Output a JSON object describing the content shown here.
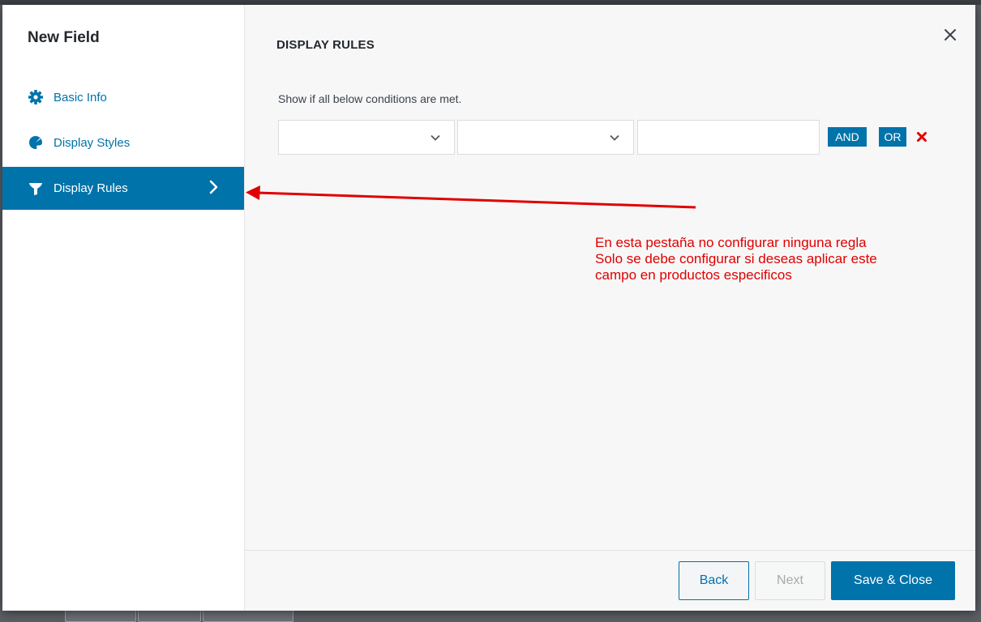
{
  "modal": {
    "sidebar": {
      "title": "New Field",
      "items": [
        {
          "label": "Basic Info",
          "icon": "gear-icon"
        },
        {
          "label": "Display Styles",
          "icon": "palette-icon"
        },
        {
          "label": "Display Rules",
          "icon": "filter-icon",
          "active": true
        }
      ]
    },
    "main": {
      "title": "DISPLAY RULES",
      "condition_text": "Show if all below conditions are met.",
      "rule": {
        "field_select_value": "",
        "operator_select_value": "",
        "value_input": "",
        "and_label": "AND",
        "or_label": "OR"
      }
    },
    "footer": {
      "back_label": "Back",
      "next_label": "Next",
      "save_label": "Save & Close"
    }
  },
  "annotation": {
    "lines": [
      "En esta pestaña no configurar ninguna regla",
      "Solo se debe configurar si deseas aplicar este",
      "campo en productos especificos"
    ],
    "color": "#e00000"
  },
  "colors": {
    "accent": "#0073aa",
    "remove": "#e00000"
  }
}
